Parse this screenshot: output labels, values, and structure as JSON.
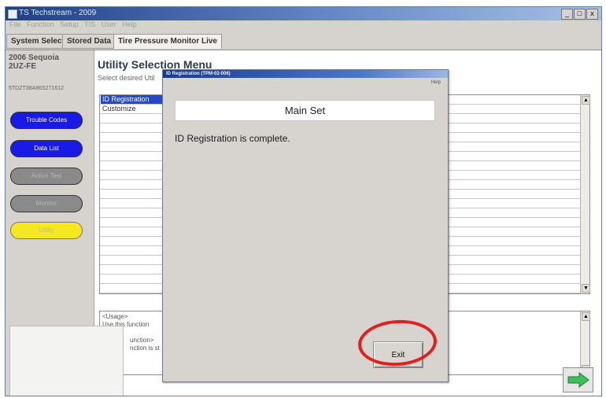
{
  "window": {
    "title": "TS Techstream - 2009",
    "menu": [
      "File",
      "Function",
      "Setup",
      "TIS",
      "User",
      "Help"
    ],
    "controls": [
      "_",
      "□",
      "x"
    ]
  },
  "tabs": [
    {
      "label": "System Select",
      "active": false
    },
    {
      "label": "Stored Data",
      "active": false
    },
    {
      "label": "Tire Pressure Monitor Live",
      "active": true
    }
  ],
  "sidebar": {
    "vehicle_line1": "2006 Sequoia",
    "vehicle_line2": "2UZ-FE",
    "vin": "5TDZT38A86S271612",
    "buttons": [
      {
        "label": "Trouble Codes",
        "style": "blue"
      },
      {
        "label": "Data List",
        "style": "blue"
      },
      {
        "label": "Active Test",
        "style": "gray"
      },
      {
        "label": "Monitor",
        "style": "gray"
      },
      {
        "label": "Utility",
        "style": "yellow"
      }
    ]
  },
  "main": {
    "heading": "Utility Selection Menu",
    "subheading": "Select desired Util",
    "list_items": [
      {
        "label": "ID Registration",
        "selected": true
      },
      {
        "label": "Customize",
        "selected": false
      }
    ],
    "usage_lines": [
      "<Usage>",
      "Use this function",
      "",
      "unction>",
      "nction is st"
    ]
  },
  "dialog": {
    "title": "ID Registration (TPM-02-006)",
    "help_label": "Help",
    "panel_title": "Main Set",
    "message": "ID Registration is complete.",
    "exit_label": "Exit"
  },
  "colors": {
    "highlight_ring": "#e51d1d",
    "selection": "#2448c9",
    "next_arrow": "#3fbf5a"
  },
  "icons": {
    "next": "right-arrow-icon",
    "scroll_up": "scroll-up-arrow-icon",
    "scroll_down": "scroll-down-arrow-icon"
  }
}
